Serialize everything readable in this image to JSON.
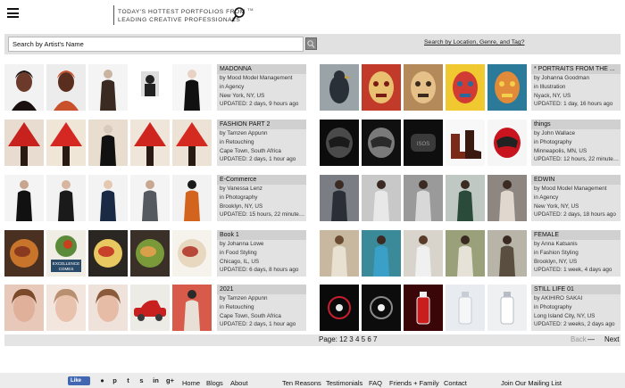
{
  "header": {
    "tagline_line1": "TODAY'S HOTTEST PORTFOLIOS FROM",
    "tagline_tm": "TM",
    "tagline_line2": "LEADING CREATIVE PROFESSIONALS"
  },
  "search": {
    "placeholder": "Search by Artist's Name",
    "advanced_link": "Search by Location, Genre, and Tag?"
  },
  "listings": [
    {
      "title": "MADONNA",
      "by": "by Mood Model Management",
      "category": "in Agency",
      "location": "New York, NY, US",
      "updated": "UPDATED: 2 days, 9 hours ago"
    },
    {
      "title": "* PORTRAITS FROM THE ...",
      "by": "by Johanna Goodman",
      "category": "in Illustration",
      "location": "Nyack, NY, US",
      "updated": "UPDATED: 1 day, 16 hours ago"
    },
    {
      "title": "FASHION PART 2",
      "by": "by Tamzen Appunn",
      "category": "in Retouching",
      "location": "Cape Town, South Africa",
      "updated": "UPDATED: 2 days, 1 hour ago"
    },
    {
      "title": "things",
      "by": "by John Wallace",
      "category": "in Photography",
      "location": "Minneapolis, MN, US",
      "updated": "UPDATED: 12 hours, 22 minutes..."
    },
    {
      "title": "E-Commerce",
      "by": "by Vanessa Lenz",
      "category": "in Photography",
      "location": "Brooklyn, NY, US",
      "updated": "UPDATED: 15 hours, 22 minutes..."
    },
    {
      "title": "EDWIN",
      "by": "by Mood Model Management",
      "category": "in Agency",
      "location": "New York, NY, US",
      "updated": "UPDATED: 2 days, 18 hours ago"
    },
    {
      "title": "Book 1",
      "by": "by Johanna Lowe",
      "category": "in Food Styling",
      "location": "Chicago, IL, US",
      "updated": "UPDATED: 6 days, 8 hours ago"
    },
    {
      "title": "FEMALE",
      "by": "by Anna Katsanis",
      "category": "in Fashion Styling",
      "location": "Brooklyn, NY, US",
      "updated": "UPDATED: 1 week, 4 days ago"
    },
    {
      "title": "2021",
      "by": "by Tamzen Appunn",
      "category": "in Retouching",
      "location": "Cape Town, South Africa",
      "updated": "UPDATED: 2 days, 1 hour ago"
    },
    {
      "title": "STILL LIFE 01",
      "by": "by AKIHIRO SAKAI",
      "category": "in Photography",
      "location": "Long Island City, NY, US",
      "updated": "UPDATED: 2 weeks, 2 days ago"
    }
  ],
  "thumb_texts": {
    "excellence": "EXCELLENCE",
    "comes": "COMES",
    "watch_brand": "ISOS"
  },
  "pagination": {
    "label": "Page:",
    "pages": [
      "1",
      "2",
      "3",
      "4",
      "5",
      "6",
      "7"
    ],
    "back": "Back",
    "dash": "—",
    "next": "Next"
  },
  "footer": {
    "like": "Like",
    "social_icons": [
      "reddit-icon",
      "pinterest-icon",
      "tumblr-icon",
      "stumbleupon-icon",
      "linkedin-icon",
      "google-plus-icon"
    ],
    "social_glyphs": [
      "●",
      "p",
      "t",
      "s",
      "in",
      "g+"
    ],
    "links": [
      "Home",
      "Blogs",
      "About",
      "Ten Reasons",
      "Testimonials",
      "FAQ",
      "Friends + Family",
      "Contact",
      "Join Our Mailing List"
    ]
  }
}
